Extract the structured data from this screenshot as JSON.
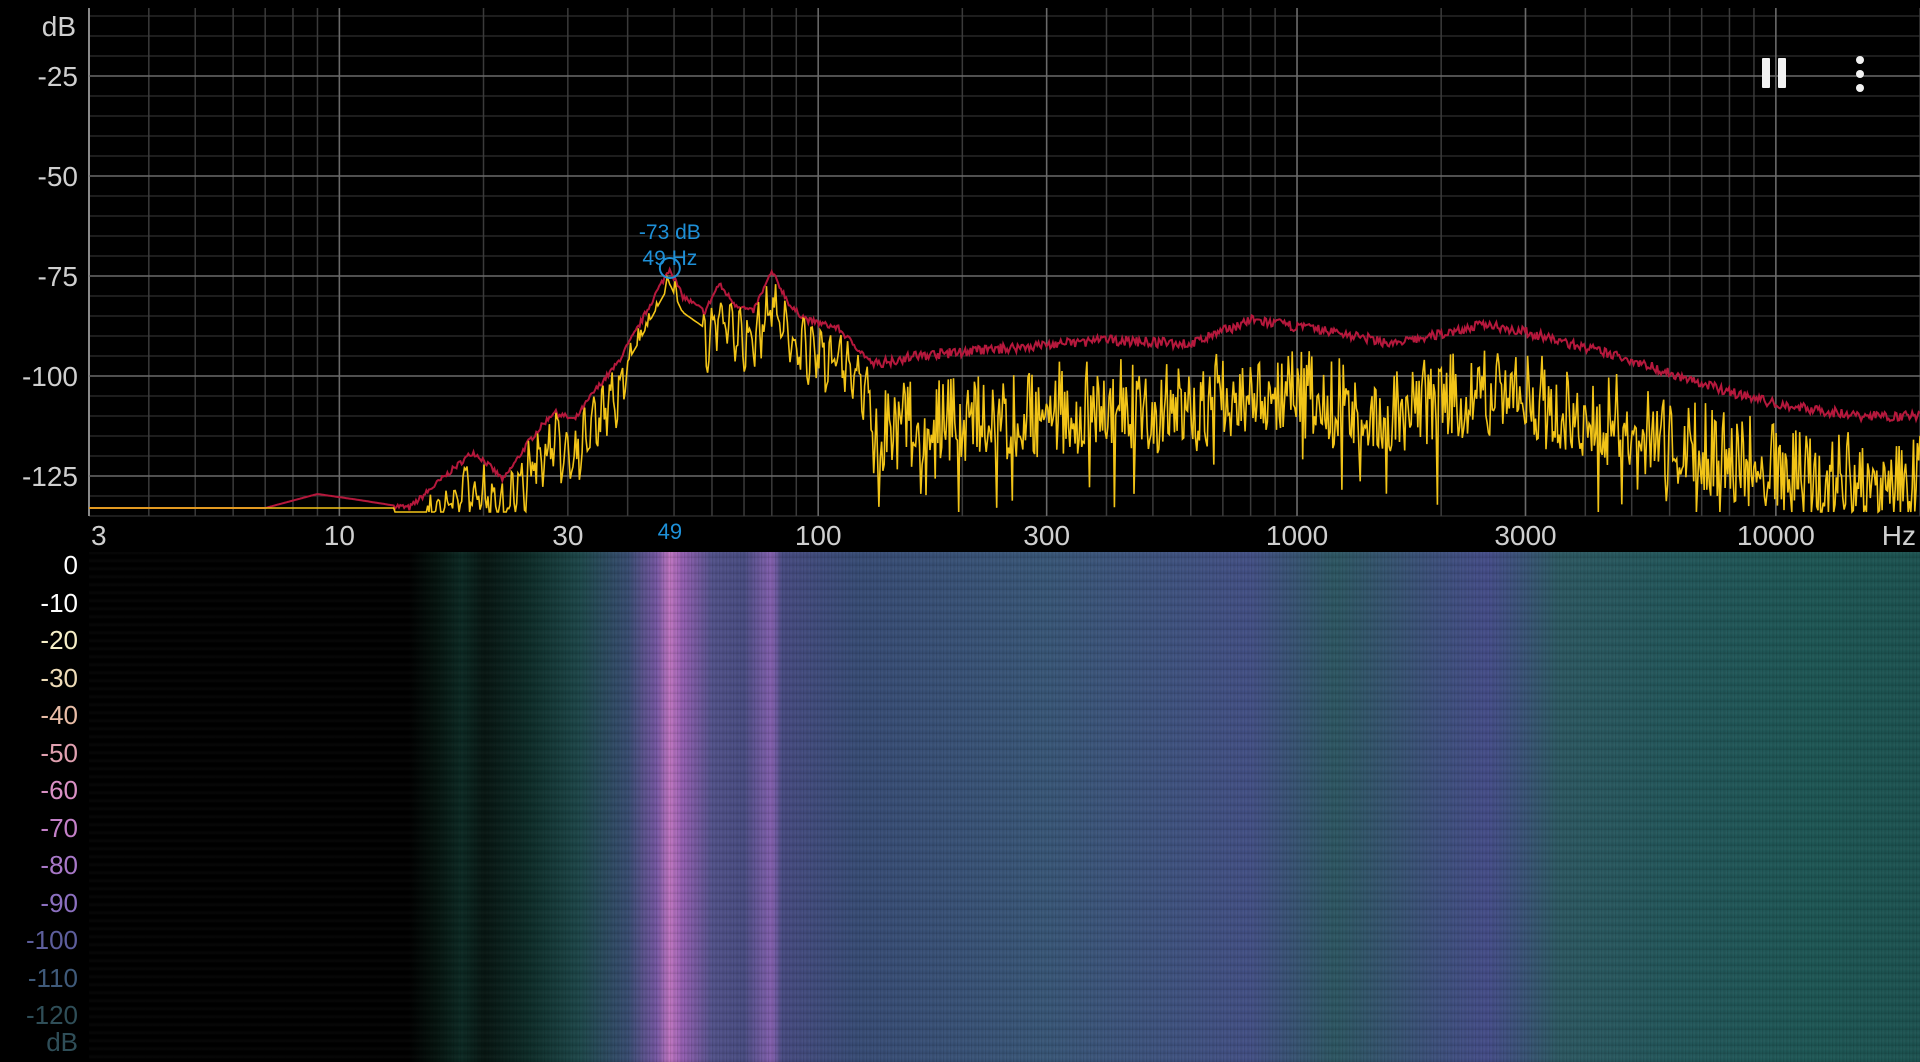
{
  "spectrum": {
    "y_unit": "dB",
    "x_unit": "Hz",
    "y_ticks": [
      "-25",
      "-50",
      "-75",
      "-100",
      "-125"
    ],
    "x_ticks": [
      "3",
      "10",
      "30",
      "100",
      "300",
      "1000",
      "3000",
      "10000"
    ],
    "peak": {
      "db_label": "-73 dB",
      "hz_label": "49 Hz",
      "marker_label": "49",
      "freq": 49,
      "db": -73
    },
    "colors": {
      "current": "#f2c418",
      "max": "#b5183c",
      "grid": "#3a3a3a",
      "grid_major": "#6a6a6a",
      "peak": "#1e90d8"
    }
  },
  "waterfall": {
    "unit": "dB",
    "labels": [
      "0",
      "-10",
      "-20",
      "-30",
      "-40",
      "-50",
      "-60",
      "-70",
      "-80",
      "-90",
      "-100",
      "-110",
      "-120"
    ],
    "label_colors": [
      "#ffffff",
      "#ffffff",
      "#f6efc8",
      "#eedcb8",
      "#e8bca6",
      "#e0a0b0",
      "#d990c4",
      "#c480c8",
      "#a878c8",
      "#8c70c0",
      "#5d5e9c",
      "#3f5a7a",
      "#2f4e58"
    ]
  },
  "controls": {
    "pause_icon": "pause-icon",
    "more_icon": "more-vert-icon"
  }
}
